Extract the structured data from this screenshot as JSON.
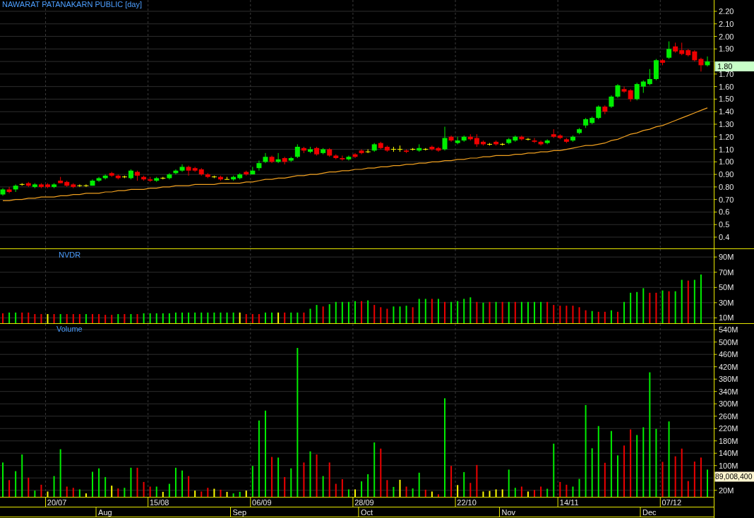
{
  "price_panel": {
    "title": "NAWARAT PATANAKARN PUBLIC [day]",
    "last_price": "1.80",
    "chart_data": {
      "type": "candlestick",
      "grid": true,
      "ylim": [
        0.31,
        2.29
      ],
      "categories": [
        null,
        null,
        null,
        null,
        null,
        null,
        null,
        null,
        null,
        null,
        null,
        null,
        null,
        null,
        null,
        null,
        null,
        null,
        null,
        null,
        null,
        null,
        null,
        null,
        null,
        null,
        null,
        null,
        null,
        null,
        null,
        null,
        null,
        null,
        null,
        null,
        null,
        null,
        null,
        null,
        null,
        null,
        null,
        null,
        null,
        null,
        null,
        null,
        null,
        null,
        null,
        null,
        null,
        null,
        null,
        null,
        null,
        null,
        null,
        null,
        null,
        null,
        null,
        null,
        null,
        null,
        null,
        null,
        null,
        null,
        null,
        null,
        null,
        null,
        null,
        null,
        null,
        null,
        null,
        null,
        null,
        null,
        null,
        null,
        null,
        null,
        null,
        null,
        null,
        null,
        null,
        null,
        null,
        null,
        null,
        null,
        null,
        null,
        null,
        null,
        null,
        null,
        null,
        null,
        null,
        null,
        null,
        null,
        null,
        null,
        null
      ],
      "yticks": [
        {
          "value": 2.2,
          "label": "2.20"
        },
        {
          "value": 2.1,
          "label": "2.10"
        },
        {
          "value": 2.0,
          "label": "2.00"
        },
        {
          "value": 1.9,
          "label": "1.90"
        },
        {
          "value": 1.7,
          "label": "1.70"
        },
        {
          "value": 1.6,
          "label": "1.60"
        },
        {
          "value": 1.5,
          "label": "1.50"
        },
        {
          "value": 1.4,
          "label": "1.40"
        },
        {
          "value": 1.3,
          "label": "1.30"
        },
        {
          "value": 1.2,
          "label": "1.20"
        },
        {
          "value": 1.1,
          "label": "1.10"
        },
        {
          "value": 1.0,
          "label": "1.00"
        },
        {
          "value": 0.9,
          "label": "0.90"
        },
        {
          "value": 0.8,
          "label": "0.80"
        },
        {
          "value": 0.7,
          "label": "0.70"
        },
        0.6,
        0.5,
        0.4
      ],
      "ohlc": [
        [
          0.74,
          0.79,
          0.73,
          0.78
        ],
        [
          0.78,
          0.8,
          0.75,
          0.76
        ],
        [
          0.78,
          0.82,
          0.76,
          0.81
        ],
        [
          0.82,
          0.83,
          0.81,
          0.82
        ],
        [
          0.83,
          0.84,
          0.8,
          0.81
        ],
        [
          0.8,
          0.83,
          0.79,
          0.82
        ],
        [
          0.82,
          0.83,
          0.79,
          0.8
        ],
        [
          0.82,
          0.83,
          0.79,
          0.8
        ],
        [
          0.8,
          0.83,
          0.79,
          0.82
        ],
        [
          0.85,
          0.88,
          0.83,
          0.83
        ],
        [
          0.84,
          0.85,
          0.8,
          0.81
        ],
        [
          0.82,
          0.83,
          0.79,
          0.8
        ],
        [
          0.81,
          0.82,
          0.8,
          0.81
        ],
        [
          0.81,
          0.82,
          0.8,
          0.81
        ],
        [
          0.81,
          0.86,
          0.81,
          0.85
        ],
        [
          0.85,
          0.88,
          0.84,
          0.87
        ],
        [
          0.87,
          0.9,
          0.86,
          0.89
        ],
        [
          0.91,
          0.92,
          0.88,
          0.89
        ],
        [
          0.89,
          0.9,
          0.86,
          0.87
        ],
        [
          0.88,
          0.89,
          0.87,
          0.88
        ],
        [
          0.87,
          0.94,
          0.86,
          0.93
        ],
        [
          0.92,
          0.93,
          0.85,
          0.89
        ],
        [
          0.88,
          0.89,
          0.85,
          0.86
        ],
        [
          0.86,
          0.88,
          0.84,
          0.85
        ],
        [
          0.85,
          0.88,
          0.84,
          0.87
        ],
        [
          0.87,
          0.88,
          0.86,
          0.87
        ],
        [
          0.87,
          0.91,
          0.86,
          0.9
        ],
        [
          0.91,
          0.94,
          0.9,
          0.93
        ],
        [
          0.93,
          0.98,
          0.92,
          0.96
        ],
        [
          0.96,
          0.97,
          0.89,
          0.93
        ],
        [
          0.95,
          0.96,
          0.92,
          0.93
        ],
        [
          0.94,
          0.95,
          0.89,
          0.9
        ],
        [
          0.9,
          0.91,
          0.87,
          0.88
        ],
        [
          0.88,
          0.89,
          0.87,
          0.88
        ],
        [
          0.88,
          0.89,
          0.85,
          0.86
        ],
        [
          0.86,
          0.88,
          0.86,
          0.86
        ],
        [
          0.86,
          0.89,
          0.85,
          0.88
        ],
        [
          0.87,
          0.91,
          0.86,
          0.9
        ],
        [
          0.92,
          0.93,
          0.89,
          0.9
        ],
        [
          0.9,
          0.96,
          0.9,
          0.93
        ],
        [
          0.95,
          1.01,
          0.93,
          0.99
        ],
        [
          1.0,
          1.07,
          0.99,
          1.04
        ],
        [
          1.04,
          1.05,
          0.99,
          1.0
        ],
        [
          1.0,
          1.07,
          0.99,
          1.02
        ],
        [
          1.03,
          1.04,
          0.98,
          1.0
        ],
        [
          1.01,
          1.04,
          1.0,
          1.03
        ],
        [
          1.04,
          1.14,
          1.03,
          1.12
        ],
        [
          1.11,
          1.12,
          1.07,
          1.09
        ],
        [
          1.08,
          1.12,
          1.07,
          1.1
        ],
        [
          1.11,
          1.12,
          1.05,
          1.06
        ],
        [
          1.07,
          1.11,
          1.06,
          1.1
        ],
        [
          1.1,
          1.11,
          1.04,
          1.05
        ],
        [
          1.05,
          1.06,
          1.02,
          1.03
        ],
        [
          1.03,
          1.05,
          1.01,
          1.02
        ],
        [
          1.02,
          1.05,
          1.01,
          1.04
        ],
        [
          1.06,
          1.07,
          1.03,
          1.04
        ],
        [
          1.09,
          1.1,
          1.06,
          1.07
        ],
        [
          1.08,
          1.1,
          1.07,
          1.08
        ],
        [
          1.09,
          1.15,
          1.08,
          1.14
        ],
        [
          1.15,
          1.16,
          1.1,
          1.11
        ],
        [
          1.12,
          1.13,
          1.08,
          1.09
        ],
        [
          1.1,
          1.12,
          1.08,
          1.1
        ],
        [
          1.1,
          1.13,
          1.08,
          1.1
        ],
        [
          1.09,
          1.1,
          1.07,
          1.08
        ],
        [
          1.1,
          1.11,
          1.09,
          1.1
        ],
        [
          1.09,
          1.14,
          1.08,
          1.11
        ],
        [
          1.1,
          1.11,
          1.09,
          1.1
        ],
        [
          1.12,
          1.13,
          1.09,
          1.1
        ],
        [
          1.11,
          1.12,
          1.08,
          1.09
        ],
        [
          1.1,
          1.28,
          1.09,
          1.19
        ],
        [
          1.2,
          1.21,
          1.16,
          1.17
        ],
        [
          1.15,
          1.2,
          1.14,
          1.17
        ],
        [
          1.17,
          1.21,
          1.16,
          1.2
        ],
        [
          1.2,
          1.22,
          1.17,
          1.18
        ],
        [
          1.19,
          1.22,
          1.12,
          1.14
        ],
        [
          1.16,
          1.17,
          1.13,
          1.14
        ],
        [
          1.14,
          1.15,
          1.13,
          1.14
        ],
        [
          1.16,
          1.17,
          1.13,
          1.14
        ],
        [
          1.14,
          1.15,
          1.13,
          1.14
        ],
        [
          1.15,
          1.19,
          1.14,
          1.18
        ],
        [
          1.17,
          1.21,
          1.16,
          1.2
        ],
        [
          1.2,
          1.21,
          1.17,
          1.18
        ],
        [
          1.18,
          1.19,
          1.17,
          1.18
        ],
        [
          1.17,
          1.19,
          1.15,
          1.16
        ],
        [
          1.16,
          1.17,
          1.13,
          1.14
        ],
        [
          1.15,
          1.18,
          1.14,
          1.17
        ],
        [
          1.22,
          1.26,
          1.19,
          1.2
        ],
        [
          1.21,
          1.22,
          1.18,
          1.19
        ],
        [
          1.18,
          1.19,
          1.15,
          1.16
        ],
        [
          1.17,
          1.21,
          1.16,
          1.2
        ],
        [
          1.23,
          1.27,
          1.22,
          1.26
        ],
        [
          1.29,
          1.35,
          1.27,
          1.34
        ],
        [
          1.31,
          1.36,
          1.3,
          1.35
        ],
        [
          1.35,
          1.45,
          1.34,
          1.44
        ],
        [
          1.44,
          1.45,
          1.38,
          1.4
        ],
        [
          1.44,
          1.53,
          1.43,
          1.52
        ],
        [
          1.52,
          1.62,
          1.51,
          1.61
        ],
        [
          1.58,
          1.6,
          1.55,
          1.56
        ],
        [
          1.57,
          1.58,
          1.48,
          1.5
        ],
        [
          1.5,
          1.63,
          1.49,
          1.62
        ],
        [
          1.6,
          1.65,
          1.55,
          1.64
        ],
        [
          1.62,
          1.74,
          1.61,
          1.66
        ],
        [
          1.66,
          1.82,
          1.65,
          1.81
        ],
        [
          1.81,
          1.82,
          1.77,
          1.79
        ],
        [
          1.83,
          1.96,
          1.82,
          1.9
        ],
        [
          1.92,
          1.95,
          1.87,
          1.88
        ],
        [
          1.89,
          1.95,
          1.85,
          1.86
        ],
        [
          1.89,
          1.9,
          1.84,
          1.85
        ],
        [
          1.88,
          1.89,
          1.8,
          1.81
        ],
        [
          1.82,
          1.83,
          1.72,
          1.77
        ],
        [
          1.77,
          1.84,
          1.76,
          1.8
        ]
      ],
      "series": [
        {
          "type": "line",
          "color": "#f0a020",
          "values": [
            0.69,
            0.69,
            0.7,
            0.7,
            0.71,
            0.71,
            0.72,
            0.72,
            0.72,
            0.73,
            0.73,
            0.74,
            0.74,
            0.75,
            0.75,
            0.75,
            0.76,
            0.76,
            0.77,
            0.77,
            0.78,
            0.78,
            0.78,
            0.79,
            0.79,
            0.8,
            0.8,
            0.81,
            0.81,
            0.81,
            0.82,
            0.82,
            0.82,
            0.82,
            0.83,
            0.83,
            0.83,
            0.83,
            0.84,
            0.84,
            0.85,
            0.86,
            0.86,
            0.87,
            0.87,
            0.88,
            0.89,
            0.89,
            0.9,
            0.9,
            0.91,
            0.92,
            0.92,
            0.93,
            0.93,
            0.94,
            0.94,
            0.95,
            0.95,
            0.96,
            0.96,
            0.97,
            0.97,
            0.98,
            0.98,
            0.99,
            0.99,
            1.0,
            1.0,
            1.01,
            1.01,
            1.02,
            1.02,
            1.03,
            1.03,
            1.04,
            1.04,
            1.05,
            1.05,
            1.05,
            1.06,
            1.06,
            1.07,
            1.07,
            1.08,
            1.08,
            1.09,
            1.09,
            1.1,
            1.11,
            1.12,
            1.13,
            1.13,
            1.14,
            1.15,
            1.17,
            1.18,
            1.2,
            1.22,
            1.23,
            1.25,
            1.26,
            1.28,
            1.29,
            1.31,
            1.33,
            1.35,
            1.37,
            1.39,
            1.41,
            1.43
          ]
        }
      ]
    }
  },
  "nvdr_panel": {
    "chart_data": {
      "type": "bar",
      "grid": true,
      "ylim": [
        1.5,
        101.3
      ],
      "categories": [
        null,
        null,
        null,
        null,
        null,
        null,
        null,
        null,
        null,
        null,
        null,
        null,
        null,
        null,
        null,
        null,
        null,
        null,
        null,
        null,
        null,
        null,
        null,
        null,
        null,
        null,
        null,
        null,
        null,
        null,
        null,
        null,
        null,
        null,
        null,
        null,
        null,
        null,
        null,
        null,
        null,
        null,
        null,
        null,
        null,
        null,
        null,
        null,
        null,
        null,
        null,
        null,
        null,
        null,
        null,
        null,
        null,
        null,
        null,
        null,
        null,
        null,
        null,
        null,
        null,
        null,
        null,
        null,
        null,
        null,
        null,
        null,
        null,
        null,
        null,
        null,
        null,
        null,
        null,
        null,
        null,
        null,
        null,
        null,
        null,
        null,
        null,
        null,
        null,
        null,
        null,
        null,
        null,
        null,
        null,
        null,
        null,
        null,
        null,
        null,
        null,
        null,
        null,
        null,
        null,
        null,
        null,
        null,
        null,
        null,
        null
      ],
      "yticks": [
        {
          "value": 90,
          "label": "90M"
        },
        {
          "value": 70,
          "label": "70M"
        },
        {
          "value": 50,
          "label": "50M"
        },
        {
          "value": 30,
          "label": "30M"
        },
        {
          "value": 10,
          "label": "10M"
        }
      ],
      "series": [
        {
          "name": "NVDR",
          "values": [
            16,
            17,
            17,
            17,
            17,
            15,
            15,
            15,
            15,
            15,
            15,
            15,
            15,
            15,
            15,
            15,
            14,
            14,
            15,
            15,
            15,
            15,
            16,
            16,
            16,
            16,
            16,
            17,
            17,
            17,
            17,
            17,
            17,
            17,
            17,
            17,
            17,
            17,
            15,
            15,
            15,
            17,
            17,
            17,
            17,
            17,
            17,
            17,
            22,
            27,
            25,
            28,
            31,
            31,
            31,
            32,
            32,
            33,
            27,
            24,
            22,
            25,
            25,
            26,
            24,
            35,
            35,
            35,
            35,
            31,
            31,
            32,
            35,
            37,
            31,
            30,
            31,
            31,
            31,
            31,
            31,
            31,
            31,
            31,
            31,
            31,
            27,
            26,
            26,
            26,
            24,
            20,
            19,
            18,
            18,
            20,
            18,
            31,
            43,
            44,
            49,
            43,
            43,
            46,
            45,
            45,
            60,
            59,
            60,
            67,
            null
          ],
          "colors": [
            "#ee0000",
            "#00ee00",
            "#00ee00",
            "#ee0000",
            "#ee0000",
            "#ee0000",
            "#ee0000",
            "#ffff00",
            "#ee0000",
            "#00ee00",
            "#ee0000",
            "#ee0000",
            "#ee0000",
            "#00ee00",
            "#ee0000",
            "#ee0000",
            "#ee0000",
            "#ee0000",
            "#00ee00",
            "#ee0000",
            "#00ee00",
            "#ee0000",
            "#00ee00",
            "#00ee00",
            "#00ee00",
            "#00ee00",
            "#00ee00",
            "#00ee00",
            "#00ee00",
            "#00ee00",
            "#00ee00",
            "#00ee00",
            "#00ee00",
            "#00ee00",
            "#00ee00",
            "#00ee00",
            "#00ee00",
            "#ffff00",
            "#ee0000",
            "#ee0000",
            "#ee0000",
            "#00ee00",
            "#00ee00",
            "#ffff00",
            "#ee0000",
            "#00ee00",
            "#00ee00",
            "#ee0000",
            "#00ee00",
            "#00ee00",
            "#ee0000",
            "#00ee00",
            "#00ee00",
            "#00ee00",
            "#00ee00",
            "#00ee00",
            "#ee0000",
            "#00ee00",
            "#ee0000",
            "#ee0000",
            "#ee0000",
            "#00ee00",
            "#00ee00",
            "#00ee00",
            "#ee0000",
            "#00ee00",
            "#00ee00",
            "#ee0000",
            "#00ee00",
            "#ee0000",
            "#00ee00",
            "#00ee00",
            "#00ee00",
            "#00ee00",
            "#ee0000",
            "#00ee00",
            "#ee0000",
            "#00ee00",
            "#ee0000",
            "#00ee00",
            "#ee0000",
            "#00ee00",
            "#00ee00",
            "#00ee00",
            "#00ee00",
            "#ee0000",
            "#ee0000",
            "#ee0000",
            "#ee0000",
            "#ee0000",
            "#ee0000",
            "#ee0000",
            "#00ee00",
            "#ee0000",
            "#ee0000",
            "#00ee00",
            "#ee0000",
            "#00ee00",
            "#00ee00",
            "#00ee00",
            "#00ee00",
            "#ee0000",
            "#ee0000",
            "#00ee00",
            "#ee0000",
            "#00ee00",
            "#00ee00",
            "#ee0000",
            "#00ee00",
            "#00ee00",
            null
          ]
        }
      ]
    }
  },
  "volume_panel": {
    "last_volume": "89,008,400",
    "month_labels": [
      "Aug",
      "Sep",
      "Oct",
      "Nov",
      "Dec"
    ],
    "chart_data": {
      "type": "bar",
      "grid": true,
      "ylim": [
        0,
        561
      ],
      "categories": [
        null,
        null,
        null,
        null,
        null,
        null,
        null,
        null,
        "20/07",
        null,
        null,
        null,
        null,
        null,
        null,
        null,
        null,
        null,
        null,
        null,
        null,
        null,
        null,
        null,
        "15/08",
        null,
        null,
        null,
        null,
        null,
        null,
        null,
        null,
        null,
        null,
        null,
        null,
        null,
        null,
        null,
        "06/09",
        null,
        null,
        null,
        null,
        null,
        null,
        null,
        null,
        null,
        null,
        null,
        null,
        null,
        null,
        null,
        "28/09",
        null,
        null,
        null,
        null,
        null,
        null,
        null,
        null,
        null,
        null,
        null,
        null,
        null,
        null,
        null,
        "22/10",
        null,
        null,
        null,
        null,
        null,
        null,
        null,
        null,
        null,
        null,
        null,
        null,
        null,
        null,
        null,
        "14/11",
        null,
        null,
        null,
        null,
        null,
        null,
        null,
        null,
        null,
        null,
        null,
        null,
        null,
        null,
        null,
        "07/12",
        null,
        null,
        null,
        null,
        null,
        null
      ],
      "yticks": [
        {
          "value": 540,
          "label": "540M"
        },
        {
          "value": 500,
          "label": "500M"
        },
        {
          "value": 460,
          "label": "460M"
        },
        {
          "value": 420,
          "label": "420M"
        },
        {
          "value": 380,
          "label": "380M"
        },
        {
          "value": 340,
          "label": "340M"
        },
        {
          "value": 300,
          "label": "300M"
        },
        {
          "value": 260,
          "label": "260M"
        },
        {
          "value": 220,
          "label": "220M"
        },
        {
          "value": 180,
          "label": "180M"
        },
        {
          "value": 140,
          "label": "140M"
        },
        {
          "value": 100,
          "label": "100M"
        },
        {
          "value": 20,
          "label": "20M"
        }
      ],
      "series": [
        {
          "name": "Volume",
          "values": [
            110,
            53,
            82,
            136,
            61,
            19,
            38,
            16,
            66,
            153,
            32,
            28,
            23,
            10,
            80,
            91,
            63,
            35,
            26,
            28,
            93,
            93,
            47,
            32,
            32,
            15,
            41,
            93,
            84,
            66,
            19,
            16,
            28,
            25,
            22,
            15,
            10,
            15,
            19,
            99,
            246,
            278,
            128,
            126,
            63,
            91,
            481,
            110,
            146,
            136,
            66,
            110,
            41,
            56,
            23,
            23,
            49,
            72,
            175,
            155,
            53,
            31,
            54,
            32,
            26,
            77,
            22,
            16,
            7,
            318,
            99,
            37,
            79,
            44,
            102,
            16,
            18,
            23,
            23,
            87,
            28,
            32,
            16,
            21,
            32,
            25,
            171,
            47,
            38,
            32,
            57,
            296,
            156,
            228,
            109,
            212,
            133,
            165,
            217,
            199,
            224,
            402,
            219,
            112,
            243,
            130,
            155,
            50,
            113,
            126,
            87
          ],
          "colors": [
            "#00ee00",
            "#ee0000",
            "#00ee00",
            "#00ee00",
            "#ee0000",
            "#00ee00",
            "#ee0000",
            "#ffff00",
            "#00ee00",
            "#00ee00",
            "#ee0000",
            "#ee0000",
            "#00ee00",
            "#ffff00",
            "#00ee00",
            "#00ee00",
            "#00ee00",
            "#ffff00",
            "#ee0000",
            "#00ee00",
            "#00ee00",
            "#ee0000",
            "#ee0000",
            "#ee0000",
            "#00ee00",
            "#ffff00",
            "#00ee00",
            "#00ee00",
            "#00ee00",
            "#ee0000",
            "#ffff00",
            "#ee0000",
            "#ee0000",
            "#ffff00",
            "#ee0000",
            "#ffff00",
            "#00ee00",
            "#00ee00",
            "#ffff00",
            "#00ee00",
            "#00ee00",
            "#00ee00",
            "#ee0000",
            "#00ee00",
            "#ee0000",
            "#00ee00",
            "#00ee00",
            "#ee0000",
            "#00ee00",
            "#ee0000",
            "#00ee00",
            "#ee0000",
            "#ee0000",
            "#ee0000",
            "#00ee00",
            "#ffff00",
            "#00ee00",
            "#00ee00",
            "#00ee00",
            "#ee0000",
            "#ee0000",
            "#00ee00",
            "#ffff00",
            "#ee0000",
            "#00ee00",
            "#00ee00",
            "#ee0000",
            "#ffff00",
            "#ee0000",
            "#00ee00",
            "#ee0000",
            "#ffff00",
            "#00ee00",
            "#ee0000",
            "#ee0000",
            "#ffff00",
            "#ffff00",
            "#ffff00",
            "#ffff00",
            "#00ee00",
            "#00ee00",
            "#ee0000",
            "#ffff00",
            "#ee0000",
            "#ee0000",
            "#00ee00",
            "#00ee00",
            "#ee0000",
            "#ee0000",
            "#00ee00",
            "#00ee00",
            "#00ee00",
            "#00ee00",
            "#00ee00",
            "#ee0000",
            "#00ee00",
            "#00ee00",
            "#ee0000",
            "#ee0000",
            "#00ee00",
            "#00ee00",
            "#00ee00",
            "#00ee00",
            "#ee0000",
            "#00ee00",
            "#ee0000",
            "#ee0000",
            "#ee0000",
            "#ee0000",
            "#ee0000",
            "#00ee00"
          ]
        }
      ]
    }
  }
}
